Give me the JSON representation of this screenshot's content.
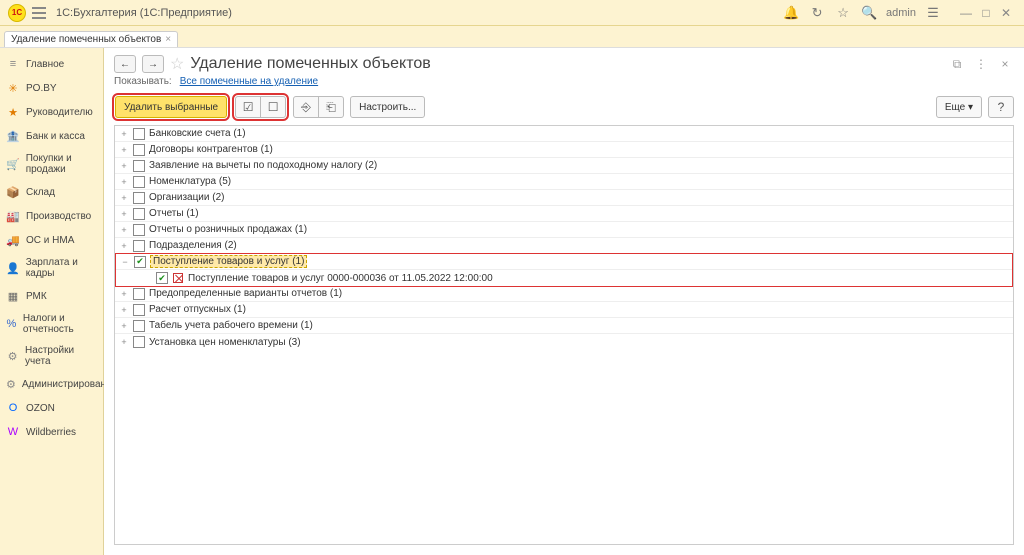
{
  "app": {
    "title": "1С:Бухгалтерия  (1С:Предприятие)",
    "user": "admin"
  },
  "tab": {
    "label": "Удаление помеченных объектов"
  },
  "nav": {
    "items": [
      {
        "label": "Главное",
        "icon": "≡",
        "color": "#888"
      },
      {
        "label": "PO.BY",
        "icon": "✳",
        "color": "#e07b00"
      },
      {
        "label": "Руководителю",
        "icon": "★",
        "color": "#e07b00"
      },
      {
        "label": "Банк и касса",
        "icon": "🏦",
        "color": "#2aa"
      },
      {
        "label": "Покупки и продажи",
        "icon": "🛒",
        "color": "#2aa"
      },
      {
        "label": "Склад",
        "icon": "📦",
        "color": "#5a8"
      },
      {
        "label": "Производство",
        "icon": "🏭",
        "color": "#5a8"
      },
      {
        "label": "ОС и НМА",
        "icon": "🚚",
        "color": "#5a8"
      },
      {
        "label": "Зарплата и кадры",
        "icon": "👤",
        "color": "#3b7"
      },
      {
        "label": "РМК",
        "icon": "▦",
        "color": "#666"
      },
      {
        "label": "Налоги и отчетность",
        "icon": "%",
        "color": "#36c"
      },
      {
        "label": "Настройки учета",
        "icon": "⚙",
        "color": "#888"
      },
      {
        "label": "Администрирование",
        "icon": "⚙",
        "color": "#888"
      },
      {
        "label": "OZON",
        "icon": "O",
        "color": "#06f"
      },
      {
        "label": "Wildberries",
        "icon": "W",
        "color": "#a0f"
      }
    ]
  },
  "page": {
    "title": "Удаление помеченных объектов",
    "filter_label": "Показывать:",
    "filter_link": "Все помеченные на удаление"
  },
  "toolbar": {
    "delete": "Удалить выбранные",
    "configure": "Настроить...",
    "more": "Еще",
    "help": "?"
  },
  "tree": {
    "rows": [
      {
        "label": "Банковские счета (1)",
        "expander": "+",
        "checked": false
      },
      {
        "label": "Договоры контрагентов (1)",
        "expander": "+",
        "checked": false
      },
      {
        "label": "Заявление на вычеты по подоходному налогу (2)",
        "expander": "+",
        "checked": false
      },
      {
        "label": "Номенклатура (5)",
        "expander": "+",
        "checked": false
      },
      {
        "label": "Организации (2)",
        "expander": "+",
        "checked": false
      },
      {
        "label": "Отчеты (1)",
        "expander": "+",
        "checked": false
      },
      {
        "label": "Отчеты о розничных продажах (1)",
        "expander": "+",
        "checked": false
      },
      {
        "label": "Подразделения (2)",
        "expander": "+",
        "checked": false
      },
      {
        "label": "Поступление товаров и услуг (1)",
        "expander": "−",
        "checked": true,
        "highlighted": true
      },
      {
        "label": "Поступление товаров и услуг 0000-000036 от 11.05.2022 12:00:00",
        "child": true,
        "checked": true,
        "marked": true
      },
      {
        "label": "Предопределенные варианты отчетов (1)",
        "expander": "+",
        "checked": false
      },
      {
        "label": "Расчет отпускных (1)",
        "expander": "+",
        "checked": false
      },
      {
        "label": "Табель учета рабочего времени (1)",
        "expander": "+",
        "checked": false
      },
      {
        "label": "Установка цен номенклатуры (3)",
        "expander": "+",
        "checked": false
      }
    ]
  }
}
